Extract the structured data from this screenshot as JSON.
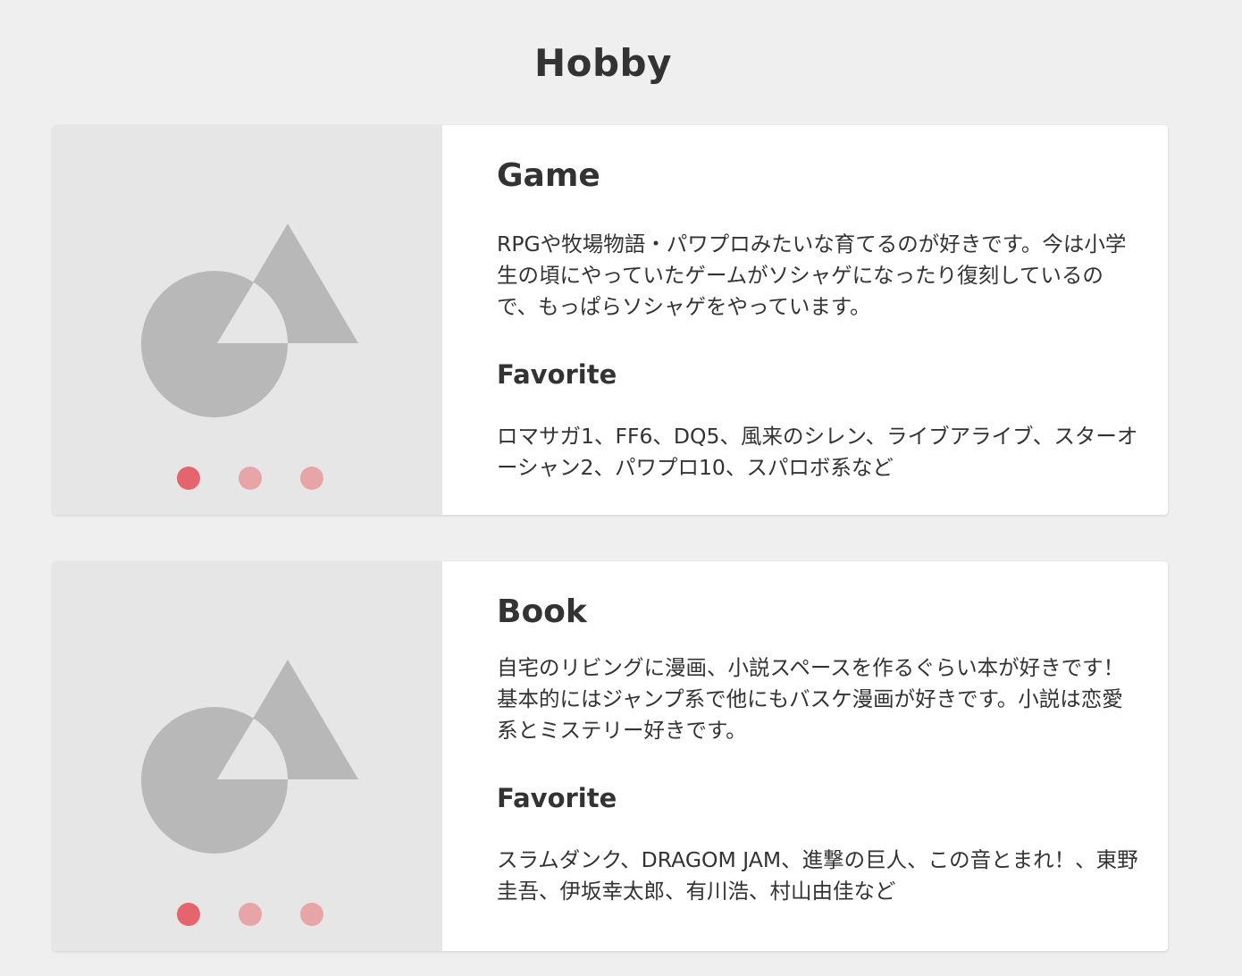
{
  "page": {
    "title": "Hobby"
  },
  "colors": {
    "background": "#efefef",
    "card": "#ffffff",
    "media_bg": "#e6e6e6",
    "shape": "#b8b8b8",
    "dot_active": "#e5656e",
    "dot_inactive": "#e8a5a8",
    "text": "#333333"
  },
  "cards": [
    {
      "title": "Game",
      "description": "RPGや牧場物語・パワプロみたいな育てるのが好きです。今は小学生の頃にやっていたゲームがソシャゲになったり復刻しているので、もっぱらソシャゲをやっています。",
      "favorite_heading": "Favorite",
      "favorites": "ロマサガ1、FF6、DQ5、風来のシレン、ライブアライブ、スターオーシャン2、パワプロ10、スパロボ系など",
      "image_icon": "shapes-placeholder-icon",
      "carousel_active_index": 0,
      "carousel_count": 3
    },
    {
      "title": "Book",
      "description": "自宅のリビングに漫画、小説スペースを作るぐらい本が好きです！基本的にはジャンプ系で他にもバスケ漫画が好きです。小説は恋愛系とミステリー好きです。",
      "favorite_heading": "Favorite",
      "favorites": "スラムダンク、DRAGOM JAM、進撃の巨人、この音とまれ！、東野圭吾、伊坂幸太郎、有川浩、村山由佳など",
      "image_icon": "shapes-placeholder-icon",
      "carousel_active_index": 0,
      "carousel_count": 3
    }
  ]
}
